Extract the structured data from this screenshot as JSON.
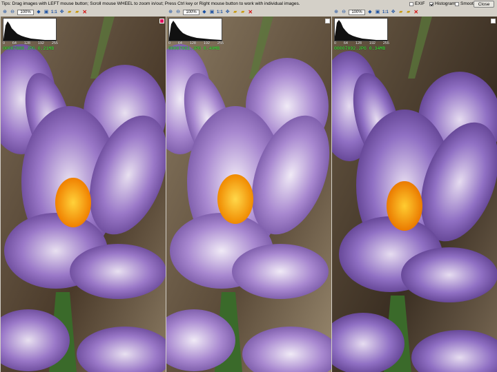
{
  "tips": "Tips: Drag images with LEFT mouse button; Scroll mouse WHEEL to zoom in/out; Press Ctrl key or Right mouse button to work with individual images.",
  "options": [
    {
      "label": "EXIF",
      "checked": false
    },
    {
      "label": "Histogram",
      "checked": true
    },
    {
      "label": "Smooth",
      "checked": false
    }
  ],
  "close_label": "Close",
  "colors": {
    "active_selector": "#e0125e",
    "file_info": "#3dff3d"
  },
  "panels": [
    {
      "zoom": "100%",
      "one_to_one": "1:1",
      "hist_ticks": [
        "0",
        "64",
        "128",
        "192",
        "255"
      ],
      "file_info": "00007089.JPG    0.21MB",
      "selected": true
    },
    {
      "zoom": "100%",
      "one_to_one": "1:1",
      "hist_ticks": [
        "0",
        "64",
        "128",
        "192",
        "255"
      ],
      "file_info": "00007091.JPG    0.40MB",
      "selected": false
    },
    {
      "zoom": "100%",
      "one_to_one": "1:1",
      "hist_ticks": [
        "0",
        "64",
        "128",
        "192",
        "255"
      ],
      "file_info": "00007092.JPG    0.34MB",
      "selected": false
    }
  ]
}
